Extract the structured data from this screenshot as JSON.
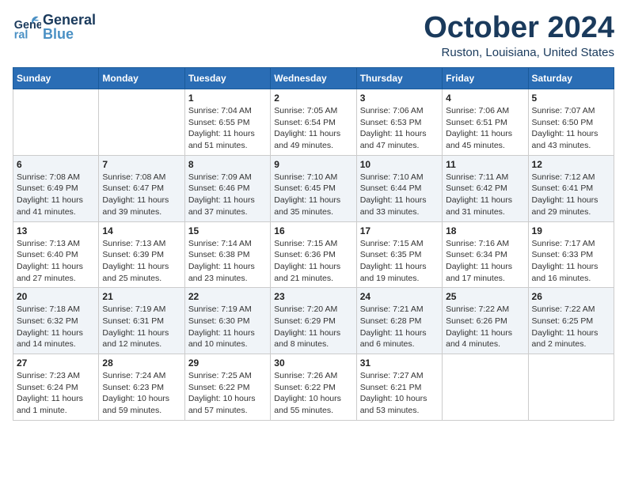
{
  "header": {
    "logo_general": "General",
    "logo_blue": "Blue",
    "month_title": "October 2024",
    "location": "Ruston, Louisiana, United States"
  },
  "days_of_week": [
    "Sunday",
    "Monday",
    "Tuesday",
    "Wednesday",
    "Thursday",
    "Friday",
    "Saturday"
  ],
  "weeks": [
    [
      {
        "day": "",
        "info": ""
      },
      {
        "day": "",
        "info": ""
      },
      {
        "day": "1",
        "info": "Sunrise: 7:04 AM\nSunset: 6:55 PM\nDaylight: 11 hours and 51 minutes."
      },
      {
        "day": "2",
        "info": "Sunrise: 7:05 AM\nSunset: 6:54 PM\nDaylight: 11 hours and 49 minutes."
      },
      {
        "day": "3",
        "info": "Sunrise: 7:06 AM\nSunset: 6:53 PM\nDaylight: 11 hours and 47 minutes."
      },
      {
        "day": "4",
        "info": "Sunrise: 7:06 AM\nSunset: 6:51 PM\nDaylight: 11 hours and 45 minutes."
      },
      {
        "day": "5",
        "info": "Sunrise: 7:07 AM\nSunset: 6:50 PM\nDaylight: 11 hours and 43 minutes."
      }
    ],
    [
      {
        "day": "6",
        "info": "Sunrise: 7:08 AM\nSunset: 6:49 PM\nDaylight: 11 hours and 41 minutes."
      },
      {
        "day": "7",
        "info": "Sunrise: 7:08 AM\nSunset: 6:47 PM\nDaylight: 11 hours and 39 minutes."
      },
      {
        "day": "8",
        "info": "Sunrise: 7:09 AM\nSunset: 6:46 PM\nDaylight: 11 hours and 37 minutes."
      },
      {
        "day": "9",
        "info": "Sunrise: 7:10 AM\nSunset: 6:45 PM\nDaylight: 11 hours and 35 minutes."
      },
      {
        "day": "10",
        "info": "Sunrise: 7:10 AM\nSunset: 6:44 PM\nDaylight: 11 hours and 33 minutes."
      },
      {
        "day": "11",
        "info": "Sunrise: 7:11 AM\nSunset: 6:42 PM\nDaylight: 11 hours and 31 minutes."
      },
      {
        "day": "12",
        "info": "Sunrise: 7:12 AM\nSunset: 6:41 PM\nDaylight: 11 hours and 29 minutes."
      }
    ],
    [
      {
        "day": "13",
        "info": "Sunrise: 7:13 AM\nSunset: 6:40 PM\nDaylight: 11 hours and 27 minutes."
      },
      {
        "day": "14",
        "info": "Sunrise: 7:13 AM\nSunset: 6:39 PM\nDaylight: 11 hours and 25 minutes."
      },
      {
        "day": "15",
        "info": "Sunrise: 7:14 AM\nSunset: 6:38 PM\nDaylight: 11 hours and 23 minutes."
      },
      {
        "day": "16",
        "info": "Sunrise: 7:15 AM\nSunset: 6:36 PM\nDaylight: 11 hours and 21 minutes."
      },
      {
        "day": "17",
        "info": "Sunrise: 7:15 AM\nSunset: 6:35 PM\nDaylight: 11 hours and 19 minutes."
      },
      {
        "day": "18",
        "info": "Sunrise: 7:16 AM\nSunset: 6:34 PM\nDaylight: 11 hours and 17 minutes."
      },
      {
        "day": "19",
        "info": "Sunrise: 7:17 AM\nSunset: 6:33 PM\nDaylight: 11 hours and 16 minutes."
      }
    ],
    [
      {
        "day": "20",
        "info": "Sunrise: 7:18 AM\nSunset: 6:32 PM\nDaylight: 11 hours and 14 minutes."
      },
      {
        "day": "21",
        "info": "Sunrise: 7:19 AM\nSunset: 6:31 PM\nDaylight: 11 hours and 12 minutes."
      },
      {
        "day": "22",
        "info": "Sunrise: 7:19 AM\nSunset: 6:30 PM\nDaylight: 11 hours and 10 minutes."
      },
      {
        "day": "23",
        "info": "Sunrise: 7:20 AM\nSunset: 6:29 PM\nDaylight: 11 hours and 8 minutes."
      },
      {
        "day": "24",
        "info": "Sunrise: 7:21 AM\nSunset: 6:28 PM\nDaylight: 11 hours and 6 minutes."
      },
      {
        "day": "25",
        "info": "Sunrise: 7:22 AM\nSunset: 6:26 PM\nDaylight: 11 hours and 4 minutes."
      },
      {
        "day": "26",
        "info": "Sunrise: 7:22 AM\nSunset: 6:25 PM\nDaylight: 11 hours and 2 minutes."
      }
    ],
    [
      {
        "day": "27",
        "info": "Sunrise: 7:23 AM\nSunset: 6:24 PM\nDaylight: 11 hours and 1 minute."
      },
      {
        "day": "28",
        "info": "Sunrise: 7:24 AM\nSunset: 6:23 PM\nDaylight: 10 hours and 59 minutes."
      },
      {
        "day": "29",
        "info": "Sunrise: 7:25 AM\nSunset: 6:22 PM\nDaylight: 10 hours and 57 minutes."
      },
      {
        "day": "30",
        "info": "Sunrise: 7:26 AM\nSunset: 6:22 PM\nDaylight: 10 hours and 55 minutes."
      },
      {
        "day": "31",
        "info": "Sunrise: 7:27 AM\nSunset: 6:21 PM\nDaylight: 10 hours and 53 minutes."
      },
      {
        "day": "",
        "info": ""
      },
      {
        "day": "",
        "info": ""
      }
    ]
  ]
}
